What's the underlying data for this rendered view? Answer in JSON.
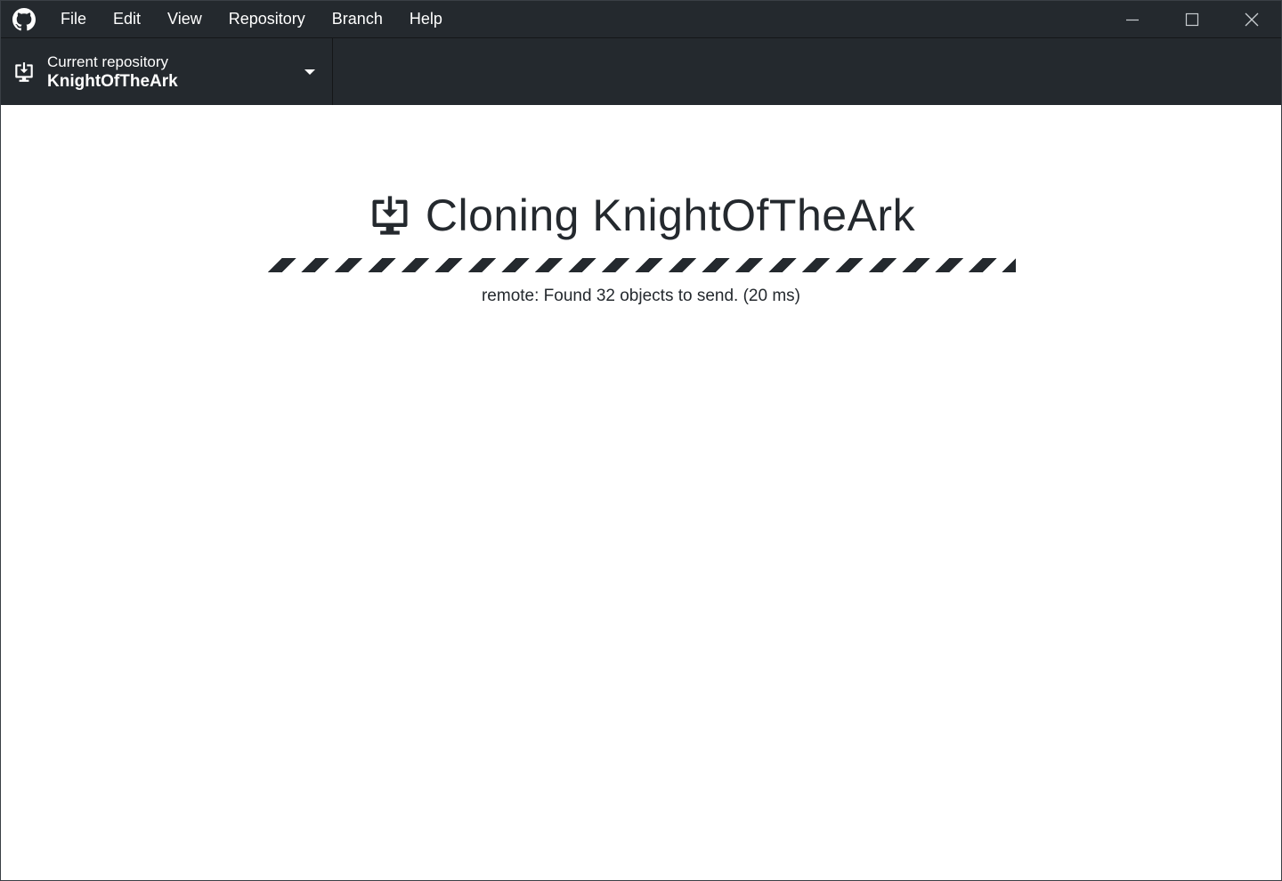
{
  "menu": {
    "items": [
      "File",
      "Edit",
      "View",
      "Repository",
      "Branch",
      "Help"
    ]
  },
  "window_controls": {
    "minimize_icon": "minimize-icon",
    "maximize_icon": "maximize-icon",
    "close_icon": "close-icon"
  },
  "toolbar": {
    "repo_label": "Current repository",
    "repo_name": "KnightOfTheArk"
  },
  "main": {
    "title": "Cloning KnightOfTheArk",
    "status": "remote: Found 32 objects to send. (20 ms)",
    "progress_indeterminate": true
  },
  "colors": {
    "titlebar_bg": "#24292e",
    "text_dark": "#24292e",
    "background": "#ffffff"
  }
}
